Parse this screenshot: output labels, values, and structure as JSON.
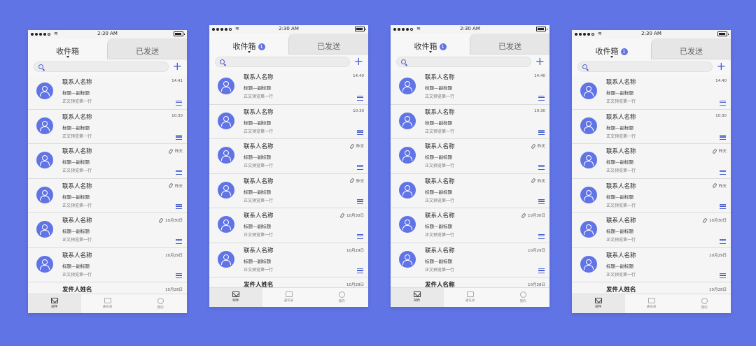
{
  "status": {
    "time": "2:30 AM"
  },
  "tabs": {
    "inbox": "收件箱",
    "inbox_badge": "1",
    "sent": "已发送"
  },
  "bottom_tabs": {
    "mail": "邮件",
    "contacts": "通讯录",
    "me": "我的"
  },
  "colors": {
    "background": "#6174e6",
    "accent": "#4a5fcf"
  },
  "phones": [
    {
      "has_badge": false,
      "items": [
        {
          "name": "联系人名称",
          "subject": "标题—副标题",
          "preview": "正文预览第一行",
          "time": "14:41",
          "attach": false
        },
        {
          "name": "联系人名称",
          "subject": "标题—副标题",
          "preview": "正文预览第一行",
          "time": "10:30",
          "attach": false
        },
        {
          "name": "联系人名称",
          "subject": "标题—副标题",
          "preview": "正文预览第一行",
          "time": "昨天",
          "attach": true
        },
        {
          "name": "联系人名称",
          "subject": "标题—副标题",
          "preview": "正文预览第一行",
          "time": "昨天",
          "attach": true
        },
        {
          "name": "联系人名称",
          "subject": "标题—副标题",
          "preview": "正文预览第一行",
          "time": "10月30日",
          "attach": true
        },
        {
          "name": "联系人名称",
          "subject": "标题—副标题",
          "preview": "正文预览第一行",
          "time": "10月29日",
          "attach": false
        }
      ],
      "partial": {
        "name": "发件人姓名",
        "time": "10月28日"
      }
    },
    {
      "has_badge": true,
      "items": [
        {
          "name": "联系人名称",
          "subject": "标题—副标题",
          "preview": "正文预览第一行",
          "time": "14:40",
          "attach": false
        },
        {
          "name": "联系人名称",
          "subject": "标题—副标题",
          "preview": "正文预览第一行",
          "time": "10:30",
          "attach": false
        },
        {
          "name": "联系人名称",
          "subject": "标题—副标题",
          "preview": "正文预览第一行",
          "time": "昨天",
          "attach": true
        },
        {
          "name": "联系人名称",
          "subject": "标题—副标题",
          "preview": "正文预览第一行",
          "time": "昨天",
          "attach": true
        },
        {
          "name": "联系人名称",
          "subject": "标题—副标题",
          "preview": "正文预览第一行",
          "time": "10月30日",
          "attach": true
        },
        {
          "name": "联系人名称",
          "subject": "标题—副标题",
          "preview": "正文预览第一行",
          "time": "10月29日",
          "attach": false
        }
      ],
      "partial": {
        "name": "发件人姓名",
        "time": "10月28日"
      }
    },
    {
      "has_badge": true,
      "items": [
        {
          "name": "联系人名称",
          "subject": "标题—副标题",
          "preview": "正文预览第一行",
          "time": "14:40",
          "attach": false
        },
        {
          "name": "联系人名称",
          "subject": "标题—副标题",
          "preview": "正文预览第一行",
          "time": "10:30",
          "attach": false
        },
        {
          "name": "联系人名称",
          "subject": "标题—副标题",
          "preview": "正文预览第一行",
          "time": "昨天",
          "attach": true
        },
        {
          "name": "联系人名称",
          "subject": "标题—副标题",
          "preview": "正文预览第一行",
          "time": "昨天",
          "attach": true
        },
        {
          "name": "联系人名称",
          "subject": "标题—副标题",
          "preview": "正文预览第一行",
          "time": "10月30日",
          "attach": true
        },
        {
          "name": "联系人名称",
          "subject": "标题—副标题",
          "preview": "正文预览第一行",
          "time": "10月29日",
          "attach": false
        }
      ],
      "partial": {
        "name": "发件人名称",
        "time": "10月28日"
      }
    },
    {
      "has_badge": true,
      "items": [
        {
          "name": "联系人名称",
          "subject": "标题—副标题",
          "preview": "正文预览第一行",
          "time": "14:40",
          "attach": false
        },
        {
          "name": "联系人名称",
          "subject": "标题—副标题",
          "preview": "正文预览第一行",
          "time": "10:30",
          "attach": false
        },
        {
          "name": "联系人名称",
          "subject": "标题—副标题",
          "preview": "正文预览第一行",
          "time": "昨天",
          "attach": true
        },
        {
          "name": "联系人名称",
          "subject": "标题—副标题",
          "preview": "正文预览第一行",
          "time": "昨天",
          "attach": true
        },
        {
          "name": "联系人名称",
          "subject": "标题—副标题",
          "preview": "正文预览第一行",
          "time": "10月30日",
          "attach": true
        },
        {
          "name": "联系人名称",
          "subject": "标题—副标题",
          "preview": "正文预览第一行",
          "time": "10月29日",
          "attach": false
        }
      ],
      "partial": {
        "name": "发件人姓名",
        "time": "10月28日"
      }
    }
  ]
}
